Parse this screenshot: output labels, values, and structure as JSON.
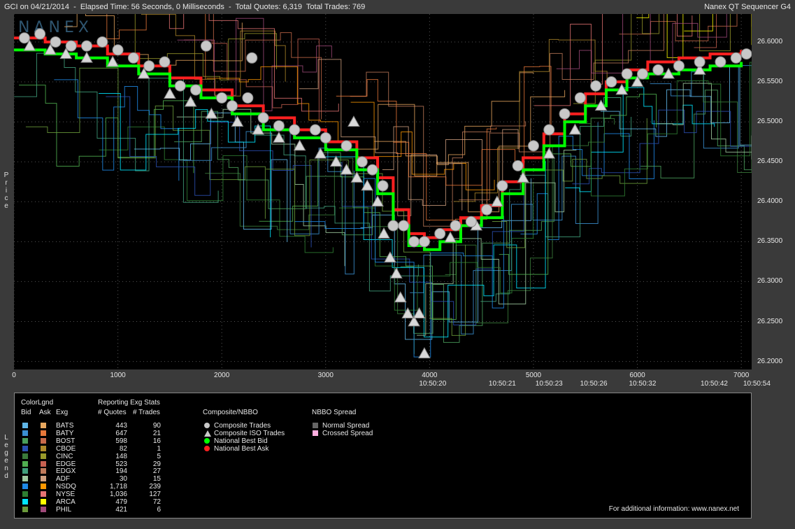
{
  "header": {
    "left": "GCI on 04/21/2014  -  Elapsed Time: 56 Seconds, 0 Milliseconds  -  Total Quotes: 6,319  Total Trades: 769",
    "right": "Nanex QT Sequencer G4",
    "watermark": "NANEX"
  },
  "side_labels": {
    "price": "Price",
    "legend": "Legend"
  },
  "chart_data": {
    "type": "line",
    "ylabel": "Price",
    "ylim": [
      26.19,
      26.635
    ],
    "xlim": [
      0,
      7100
    ],
    "yticks": [
      "26.6000",
      "26.5500",
      "26.5000",
      "26.4500",
      "26.4000",
      "26.3500",
      "26.3000",
      "26.2500",
      "26.2000"
    ],
    "ytick_values": [
      26.6,
      26.55,
      26.5,
      26.45,
      26.4,
      26.35,
      26.3,
      26.25,
      26.2
    ],
    "xticks": [
      "0",
      "1000",
      "2000",
      "3000",
      "4000",
      "5000",
      "6000",
      "7000"
    ],
    "xtick_values": [
      0,
      1000,
      2000,
      3000,
      4000,
      5000,
      6000,
      7000
    ],
    "time_labels": [
      "10:50:20",
      "10:50:21",
      "10:50:23",
      "10:50:26",
      "10:50:32",
      "10:50:42",
      "10:50:54"
    ],
    "time_label_x": [
      4030,
      4700,
      5150,
      5580,
      6050,
      6740,
      7150
    ],
    "nbbo_bid": [
      [
        0,
        26.59
      ],
      [
        300,
        26.585
      ],
      [
        600,
        26.58
      ],
      [
        900,
        26.57
      ],
      [
        1200,
        26.56
      ],
      [
        1500,
        26.545
      ],
      [
        1800,
        26.53
      ],
      [
        2100,
        26.51
      ],
      [
        2400,
        26.49
      ],
      [
        2700,
        26.48
      ],
      [
        3000,
        26.465
      ],
      [
        3300,
        26.44
      ],
      [
        3500,
        26.41
      ],
      [
        3650,
        26.37
      ],
      [
        3800,
        26.345
      ],
      [
        3950,
        26.34
      ],
      [
        4100,
        26.35
      ],
      [
        4300,
        26.37
      ],
      [
        4500,
        26.38
      ],
      [
        4700,
        26.41
      ],
      [
        4900,
        26.44
      ],
      [
        5100,
        26.47
      ],
      [
        5300,
        26.5
      ],
      [
        5500,
        26.52
      ],
      [
        5700,
        26.54
      ],
      [
        5900,
        26.555
      ],
      [
        6100,
        26.56
      ],
      [
        6400,
        26.565
      ],
      [
        6700,
        26.57
      ],
      [
        7000,
        26.575
      ]
    ],
    "nbbo_ask": [
      [
        0,
        26.605
      ],
      [
        300,
        26.6
      ],
      [
        600,
        26.595
      ],
      [
        900,
        26.585
      ],
      [
        1200,
        26.57
      ],
      [
        1500,
        26.555
      ],
      [
        1800,
        26.54
      ],
      [
        2100,
        26.52
      ],
      [
        2400,
        26.505
      ],
      [
        2700,
        26.49
      ],
      [
        3000,
        26.475
      ],
      [
        3300,
        26.455
      ],
      [
        3500,
        26.43
      ],
      [
        3650,
        26.39
      ],
      [
        3800,
        26.36
      ],
      [
        3950,
        26.355
      ],
      [
        4100,
        26.365
      ],
      [
        4300,
        26.38
      ],
      [
        4500,
        26.395
      ],
      [
        4700,
        26.425
      ],
      [
        4900,
        26.455
      ],
      [
        5100,
        26.485
      ],
      [
        5300,
        26.51
      ],
      [
        5500,
        26.535
      ],
      [
        5700,
        26.55
      ],
      [
        5900,
        26.565
      ],
      [
        6100,
        26.575
      ],
      [
        6400,
        26.58
      ],
      [
        6700,
        26.585
      ],
      [
        7000,
        26.59
      ]
    ],
    "composite_trades": [
      [
        100,
        26.605
      ],
      [
        250,
        26.61
      ],
      [
        400,
        26.6
      ],
      [
        550,
        26.595
      ],
      [
        700,
        26.595
      ],
      [
        850,
        26.6
      ],
      [
        1000,
        26.59
      ],
      [
        1150,
        26.58
      ],
      [
        1300,
        26.57
      ],
      [
        1450,
        26.575
      ],
      [
        1600,
        26.545
      ],
      [
        1750,
        26.54
      ],
      [
        1850,
        26.595
      ],
      [
        2000,
        26.53
      ],
      [
        2100,
        26.52
      ],
      [
        2250,
        26.53
      ],
      [
        2400,
        26.505
      ],
      [
        2550,
        26.495
      ],
      [
        2700,
        26.49
      ],
      [
        2900,
        26.49
      ],
      [
        3000,
        26.48
      ],
      [
        3200,
        26.47
      ],
      [
        3350,
        26.45
      ],
      [
        3450,
        26.44
      ],
      [
        3550,
        26.42
      ],
      [
        3650,
        26.37
      ],
      [
        3750,
        26.37
      ],
      [
        3850,
        26.35
      ],
      [
        3950,
        26.35
      ],
      [
        4100,
        26.36
      ],
      [
        4250,
        26.37
      ],
      [
        4400,
        26.375
      ],
      [
        4550,
        26.39
      ],
      [
        4700,
        26.42
      ],
      [
        4850,
        26.445
      ],
      [
        5000,
        26.47
      ],
      [
        5150,
        26.49
      ],
      [
        5300,
        26.51
      ],
      [
        5450,
        26.53
      ],
      [
        5600,
        26.545
      ],
      [
        5750,
        26.55
      ],
      [
        5900,
        26.56
      ],
      [
        6050,
        26.56
      ],
      [
        6200,
        26.565
      ],
      [
        6400,
        26.57
      ],
      [
        6600,
        26.575
      ],
      [
        6800,
        26.575
      ],
      [
        6950,
        26.58
      ],
      [
        7050,
        26.585
      ],
      [
        2290,
        26.58
      ]
    ],
    "iso_trades": [
      [
        150,
        26.595
      ],
      [
        350,
        26.59
      ],
      [
        500,
        26.585
      ],
      [
        700,
        26.58
      ],
      [
        950,
        26.575
      ],
      [
        1250,
        26.56
      ],
      [
        1500,
        26.535
      ],
      [
        1700,
        26.525
      ],
      [
        1900,
        26.51
      ],
      [
        2150,
        26.5
      ],
      [
        2350,
        26.49
      ],
      [
        2550,
        26.48
      ],
      [
        2750,
        26.47
      ],
      [
        2950,
        26.46
      ],
      [
        3100,
        26.45
      ],
      [
        3200,
        26.44
      ],
      [
        3300,
        26.43
      ],
      [
        3400,
        26.42
      ],
      [
        3500,
        26.4
      ],
      [
        3560,
        26.36
      ],
      [
        3620,
        26.33
      ],
      [
        3680,
        26.31
      ],
      [
        3720,
        26.28
      ],
      [
        3790,
        26.26
      ],
      [
        3850,
        26.25
      ],
      [
        3900,
        26.26
      ],
      [
        3950,
        26.21
      ],
      [
        4200,
        26.355
      ],
      [
        4450,
        26.37
      ],
      [
        4650,
        26.4
      ],
      [
        4900,
        26.43
      ],
      [
        5150,
        26.46
      ],
      [
        5400,
        26.49
      ],
      [
        5650,
        26.52
      ],
      [
        5850,
        26.54
      ],
      [
        6000,
        26.55
      ],
      [
        6300,
        26.56
      ],
      [
        6600,
        26.565
      ],
      [
        3270,
        26.5
      ]
    ],
    "legend": {
      "title": "ColorLgnd",
      "col_bid": "Bid",
      "col_ask": "Ask",
      "col_exg": "Exg",
      "stats_title": "Reporting Exg Stats",
      "col_quotes": "# Quotes",
      "col_trades": "# Trades",
      "exchanges": [
        {
          "name": "BATS",
          "quotes": "443",
          "trades": "90",
          "bid": "#5fb6e8",
          "ask": "#e8a85f"
        },
        {
          "name": "BATY",
          "quotes": "647",
          "trades": "21",
          "bid": "#3a8fd0",
          "ask": "#e8783a"
        },
        {
          "name": "BOST",
          "quotes": "598",
          "trades": "16",
          "bid": "#4a9e5a",
          "ask": "#c86a4a"
        },
        {
          "name": "CBOE",
          "quotes": "82",
          "trades": "1",
          "bid": "#2a4fb0",
          "ask": "#b08a2a"
        },
        {
          "name": "CINC",
          "quotes": "148",
          "trades": "5",
          "bid": "#3a7a3a",
          "ask": "#9a9a2a"
        },
        {
          "name": "EDGE",
          "quotes": "523",
          "trades": "29",
          "bid": "#4fae4f",
          "ask": "#c86050"
        },
        {
          "name": "EDGX",
          "quotes": "194",
          "trades": "27",
          "bid": "#3f9e7a",
          "ask": "#c07a5a"
        },
        {
          "name": "ADF",
          "quotes": "30",
          "trades": "15",
          "bid": "#9ec89e",
          "ask": "#d0a080"
        },
        {
          "name": "NSDQ",
          "quotes": "1,718",
          "trades": "239",
          "bid": "#1e88e5",
          "ask": "#ff9800"
        },
        {
          "name": "NYSE",
          "quotes": "1,036",
          "trades": "127",
          "bid": "#2e7d32",
          "ask": "#e57373"
        },
        {
          "name": "ARCA",
          "quotes": "479",
          "trades": "72",
          "bid": "#00e5ff",
          "ask": "#ffff00"
        },
        {
          "name": "PHIL",
          "quotes": "421",
          "trades": "6",
          "bid": "#6a9a3a",
          "ask": "#a04a7a"
        }
      ],
      "composite_title": "Composite/NBBO",
      "composite_items": [
        "Composite Trades",
        "Composite ISO Trades",
        "National Best Bid",
        "National Best Ask"
      ],
      "spread_title": "NBBO Spread",
      "spread_items": [
        "Normal Spread",
        "Crossed Spread"
      ]
    }
  },
  "colors": {
    "bid": "#00ff00",
    "ask": "#ff2020",
    "trade": "#c8c8c8",
    "normal_spread": "#666666",
    "crossed_spread": "#ffb0e0"
  },
  "footer": "For additional information: www.nanex.net"
}
